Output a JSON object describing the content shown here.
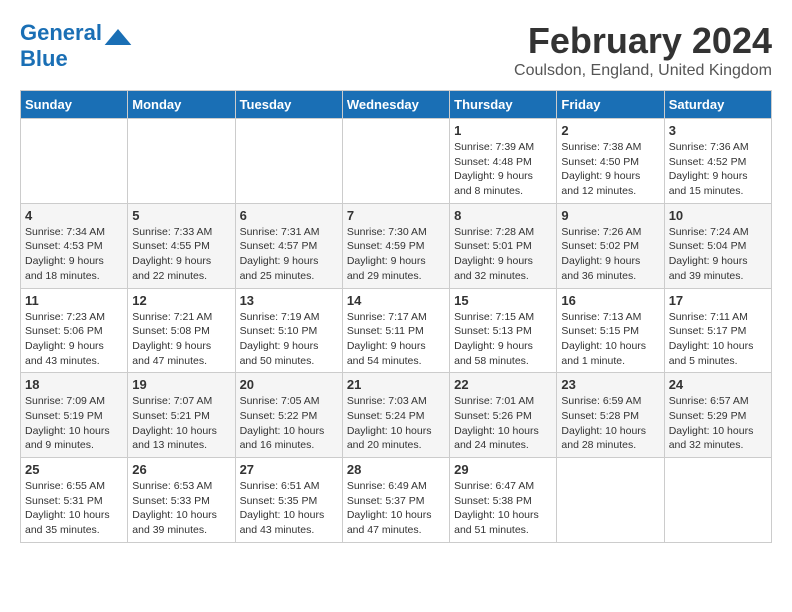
{
  "logo": {
    "text1": "General",
    "text2": "Blue"
  },
  "title": "February 2024",
  "subtitle": "Coulsdon, England, United Kingdom",
  "headers": [
    "Sunday",
    "Monday",
    "Tuesday",
    "Wednesday",
    "Thursday",
    "Friday",
    "Saturday"
  ],
  "weeks": [
    [
      {
        "day": "",
        "info": ""
      },
      {
        "day": "",
        "info": ""
      },
      {
        "day": "",
        "info": ""
      },
      {
        "day": "",
        "info": ""
      },
      {
        "day": "1",
        "info": "Sunrise: 7:39 AM\nSunset: 4:48 PM\nDaylight: 9 hours\nand 8 minutes."
      },
      {
        "day": "2",
        "info": "Sunrise: 7:38 AM\nSunset: 4:50 PM\nDaylight: 9 hours\nand 12 minutes."
      },
      {
        "day": "3",
        "info": "Sunrise: 7:36 AM\nSunset: 4:52 PM\nDaylight: 9 hours\nand 15 minutes."
      }
    ],
    [
      {
        "day": "4",
        "info": "Sunrise: 7:34 AM\nSunset: 4:53 PM\nDaylight: 9 hours\nand 18 minutes."
      },
      {
        "day": "5",
        "info": "Sunrise: 7:33 AM\nSunset: 4:55 PM\nDaylight: 9 hours\nand 22 minutes."
      },
      {
        "day": "6",
        "info": "Sunrise: 7:31 AM\nSunset: 4:57 PM\nDaylight: 9 hours\nand 25 minutes."
      },
      {
        "day": "7",
        "info": "Sunrise: 7:30 AM\nSunset: 4:59 PM\nDaylight: 9 hours\nand 29 minutes."
      },
      {
        "day": "8",
        "info": "Sunrise: 7:28 AM\nSunset: 5:01 PM\nDaylight: 9 hours\nand 32 minutes."
      },
      {
        "day": "9",
        "info": "Sunrise: 7:26 AM\nSunset: 5:02 PM\nDaylight: 9 hours\nand 36 minutes."
      },
      {
        "day": "10",
        "info": "Sunrise: 7:24 AM\nSunset: 5:04 PM\nDaylight: 9 hours\nand 39 minutes."
      }
    ],
    [
      {
        "day": "11",
        "info": "Sunrise: 7:23 AM\nSunset: 5:06 PM\nDaylight: 9 hours\nand 43 minutes."
      },
      {
        "day": "12",
        "info": "Sunrise: 7:21 AM\nSunset: 5:08 PM\nDaylight: 9 hours\nand 47 minutes."
      },
      {
        "day": "13",
        "info": "Sunrise: 7:19 AM\nSunset: 5:10 PM\nDaylight: 9 hours\nand 50 minutes."
      },
      {
        "day": "14",
        "info": "Sunrise: 7:17 AM\nSunset: 5:11 PM\nDaylight: 9 hours\nand 54 minutes."
      },
      {
        "day": "15",
        "info": "Sunrise: 7:15 AM\nSunset: 5:13 PM\nDaylight: 9 hours\nand 58 minutes."
      },
      {
        "day": "16",
        "info": "Sunrise: 7:13 AM\nSunset: 5:15 PM\nDaylight: 10 hours\nand 1 minute."
      },
      {
        "day": "17",
        "info": "Sunrise: 7:11 AM\nSunset: 5:17 PM\nDaylight: 10 hours\nand 5 minutes."
      }
    ],
    [
      {
        "day": "18",
        "info": "Sunrise: 7:09 AM\nSunset: 5:19 PM\nDaylight: 10 hours\nand 9 minutes."
      },
      {
        "day": "19",
        "info": "Sunrise: 7:07 AM\nSunset: 5:21 PM\nDaylight: 10 hours\nand 13 minutes."
      },
      {
        "day": "20",
        "info": "Sunrise: 7:05 AM\nSunset: 5:22 PM\nDaylight: 10 hours\nand 16 minutes."
      },
      {
        "day": "21",
        "info": "Sunrise: 7:03 AM\nSunset: 5:24 PM\nDaylight: 10 hours\nand 20 minutes."
      },
      {
        "day": "22",
        "info": "Sunrise: 7:01 AM\nSunset: 5:26 PM\nDaylight: 10 hours\nand 24 minutes."
      },
      {
        "day": "23",
        "info": "Sunrise: 6:59 AM\nSunset: 5:28 PM\nDaylight: 10 hours\nand 28 minutes."
      },
      {
        "day": "24",
        "info": "Sunrise: 6:57 AM\nSunset: 5:29 PM\nDaylight: 10 hours\nand 32 minutes."
      }
    ],
    [
      {
        "day": "25",
        "info": "Sunrise: 6:55 AM\nSunset: 5:31 PM\nDaylight: 10 hours\nand 35 minutes."
      },
      {
        "day": "26",
        "info": "Sunrise: 6:53 AM\nSunset: 5:33 PM\nDaylight: 10 hours\nand 39 minutes."
      },
      {
        "day": "27",
        "info": "Sunrise: 6:51 AM\nSunset: 5:35 PM\nDaylight: 10 hours\nand 43 minutes."
      },
      {
        "day": "28",
        "info": "Sunrise: 6:49 AM\nSunset: 5:37 PM\nDaylight: 10 hours\nand 47 minutes."
      },
      {
        "day": "29",
        "info": "Sunrise: 6:47 AM\nSunset: 5:38 PM\nDaylight: 10 hours\nand 51 minutes."
      },
      {
        "day": "",
        "info": ""
      },
      {
        "day": "",
        "info": ""
      }
    ]
  ]
}
